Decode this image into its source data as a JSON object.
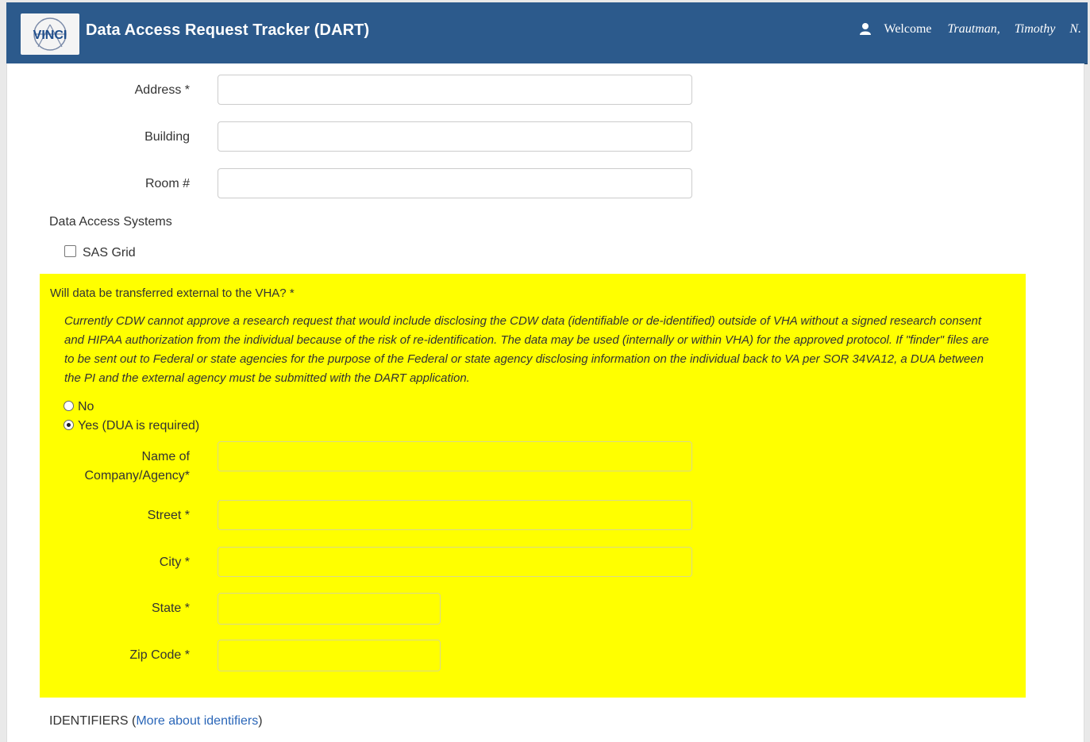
{
  "header": {
    "logo_text": "VINCI",
    "title": "Data Access Request Tracker (DART)",
    "welcome": "Welcome",
    "user_last": "Trautman,",
    "user_first": "Timothy",
    "user_initial": "N."
  },
  "form": {
    "address_label": "Address *",
    "address_value": "",
    "building_label": "Building",
    "building_value": "",
    "room_label": "Room #",
    "room_value": "",
    "systems_heading": "Data Access Systems",
    "sas_grid_label": "SAS Grid",
    "sas_grid_checked": false
  },
  "external": {
    "question": "Will data be transferred external to the VHA? *",
    "notice": "Currently CDW cannot approve a research request that would include disclosing the CDW data (identifiable or de-identified) outside of VHA without a signed research consent and HIPAA authorization from the individual because of the risk of re-identification. The data may be used (internally or within VHA) for the approved protocol. If \"finder\" files are to be sent out to Federal or state agencies for the purpose of the Federal or state agency disclosing information on the individual back to VA per SOR 34VA12, a DUA between the PI and the external agency must be submitted with the DART application.",
    "option_no": "No",
    "option_yes": "Yes (DUA is required)",
    "selected": "yes",
    "company_label_line1": "Name of",
    "company_label_line2": "Company/Agency*",
    "street_label": "Street *",
    "city_label": "City *",
    "state_label": "State *",
    "zip_label": "Zip Code *",
    "company_value": "",
    "street_value": "",
    "city_value": "",
    "state_value": "",
    "zip_value": ""
  },
  "identifiers": {
    "heading": "IDENTIFIERS",
    "open_paren": "(",
    "link": "More about identifiers",
    "close_paren": ")"
  },
  "colors": {
    "header_bg": "#2c5a8c",
    "highlight": "#ffff00",
    "link": "#2a66b8"
  }
}
